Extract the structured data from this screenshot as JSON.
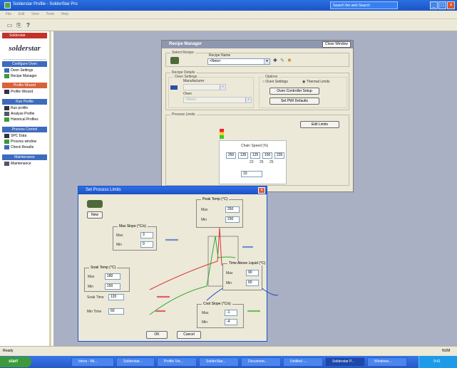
{
  "app": {
    "title": "Solderstar Profile - SolderStar Pro",
    "search_text": "Search the web Search",
    "min": "_",
    "max": "□",
    "close": "×"
  },
  "menu": [
    "File",
    "Edit",
    "View",
    "Tools",
    "Help"
  ],
  "toolbar": {
    "icons": [
      "new-icon",
      "open-icon",
      "help-icon"
    ]
  },
  "sidebar": {
    "logo": "solderstar",
    "sections": [
      {
        "header": "Solderstar",
        "color": "#c2332a",
        "items": []
      },
      {
        "header": "Configure Oven",
        "color": "#3d6bbf",
        "items": [
          "Oven Settings",
          "Recipe Manager"
        ]
      },
      {
        "header": "Profile Wizard",
        "color": "#d9623a",
        "items": [
          "Profile Wizard"
        ]
      },
      {
        "header": "Run Profile",
        "color": "#3d6bbf",
        "items": [
          "Run profile",
          "Analyse Profile",
          "Historical Profiles"
        ]
      },
      {
        "header": "Process Control",
        "color": "#3d6bbf",
        "items": [
          "SPC Data",
          "Process window",
          "Check Results"
        ]
      },
      {
        "header": "Maintenance",
        "color": "#3d6bbf",
        "items": [
          "Maintenance"
        ]
      }
    ]
  },
  "recipe_manager": {
    "title": "Recipe Manager",
    "close_button": "Close Window",
    "section_recipe": "Select Recipe",
    "recipe_name_label": "Recipe Name",
    "recipe_name_value": "<New>",
    "section_details": "Recipe Details",
    "section_settings": "Oven Settings",
    "manufacturer_label": "Manufacturer",
    "manufacturer_value": "",
    "oven_label": "Oven",
    "oven_value": "<New>",
    "section_options": "Options",
    "option_1": "Oven Settings",
    "option_2": "Thermal Limits",
    "button_1": "Oven Controller Setup",
    "button_2": "Set PWI Defaults",
    "section_limits": "Process Limits",
    "edit_limits": "Edit Limits",
    "popup_title": "Chain Speed (%)",
    "popup_values": [
      "250",
      "135",
      "125",
      "150",
      "235"
    ],
    "popup_small": [
      "23",
      "25",
      "25"
    ],
    "popup_bottom": "10"
  },
  "limits_dialog": {
    "title": "Set Process Limits",
    "new_button": "New",
    "ok": "OK",
    "cancel": "Cancel",
    "groups": {
      "ramp": {
        "title": "Max Slope (°C/s)",
        "max_label": "Max",
        "max": "3",
        "min_label": "Min",
        "min": "0"
      },
      "peak": {
        "title": "Peak Temp (°C)",
        "max_label": "Max",
        "max": "250",
        "min_label": "Min",
        "min": "230"
      },
      "tal": {
        "title": "Time Above Liquid (°C)",
        "max_label": "Max",
        "max": "90",
        "min_label": "Min",
        "min": "60"
      },
      "soak": {
        "title": "Soak Temp (°C)",
        "max_label": "Max",
        "max": "180",
        "min_label": "Min",
        "min": "150"
      },
      "soak_time_label": "Soak Time",
      "soak_time": "120",
      "soak_time_min_label": "Min Time",
      "soak_time_min": "60",
      "cool": {
        "title": "Cool Slope (°C/s)",
        "max_label": "Max",
        "max": "-1",
        "min_label": "Min",
        "min": "-4"
      }
    }
  },
  "statusbar": {
    "left": "Ready",
    "right": "NUM"
  },
  "taskbar": {
    "start": "start",
    "items": [
      "Inbox - Mi...",
      "Solderstar...",
      "Profile Vie...",
      "SolderStar...",
      "Document...",
      "Untitled -...",
      "Solderstar P...",
      "Windows..."
    ],
    "tray": "9:41"
  }
}
